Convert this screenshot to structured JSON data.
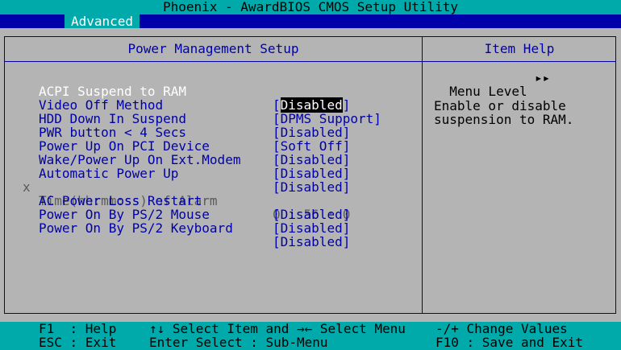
{
  "app": {
    "title": "Phoenix - AwardBIOS CMOS Setup Utility",
    "menu_tab": "Advanced"
  },
  "panel": {
    "title": "Power Management Setup",
    "help_title": "Item Help"
  },
  "settings": [
    {
      "label": "ACPI Suspend to RAM",
      "value_open": "[",
      "value": "Disabled",
      "value_close": "]",
      "state": "selected"
    },
    {
      "label": "Video Off Method",
      "value_open": "[",
      "value": "DPMS Support",
      "value_close": "]",
      "state": "normal"
    },
    {
      "label": "HDD Down In Suspend",
      "value_open": "[",
      "value": "Disabled",
      "value_close": "]",
      "state": "normal"
    },
    {
      "label": "PWR button < 4 Secs",
      "value_open": "[",
      "value": "Soft Off",
      "value_close": "]",
      "state": "normal"
    },
    {
      "label": "Power Up On PCI Device",
      "value_open": "[",
      "value": "Disabled",
      "value_close": "]",
      "state": "normal"
    },
    {
      "label": "Wake/Power Up On Ext.Modem",
      "value_open": "[",
      "value": "Disabled",
      "value_close": "]",
      "state": "normal"
    },
    {
      "label": "Automatic Power Up",
      "value_open": "[",
      "value": "Disabled",
      "value_close": "]",
      "state": "normal"
    },
    {
      "label": "Time(hh:mm:ss) of Alarm",
      "value_open": "",
      "value": "0 : 56 : 0",
      "value_close": "",
      "state": "disabled",
      "mark": "x"
    },
    {
      "label": "AC Power Loss Restart",
      "value_open": "[",
      "value": "Disabled",
      "value_close": "]",
      "state": "normal"
    },
    {
      "label": "Power On By PS/2 Mouse",
      "value_open": "[",
      "value": "Disabled",
      "value_close": "]",
      "state": "normal"
    },
    {
      "label": "Power On By PS/2 Keyboard",
      "value_open": "[",
      "value": "Disabled",
      "value_close": "]",
      "state": "normal"
    }
  ],
  "help": {
    "menu_level_label": "Menu Level",
    "menu_level_arrows": "▸▸",
    "line1": "Enable or disable",
    "line2": "suspension to RAM."
  },
  "footer": {
    "row1_col1": "F1  : Help",
    "row1_col2": "↑↓ Select Item and →← Select Menu",
    "row1_col3": "-/+ Change Values",
    "row2_col1": "ESC : Exit",
    "row2_col2": "Enter Select : Sub-Menu",
    "row2_col3": "F10 : Save and Exit"
  },
  "colors": {
    "background": "#b4b4b4",
    "frame": "#0000aa",
    "bar": "#00aaaa",
    "highlight_bg": "#000000",
    "highlight_fg": "#ffffff",
    "disabled_fg": "#5a5a5a"
  }
}
